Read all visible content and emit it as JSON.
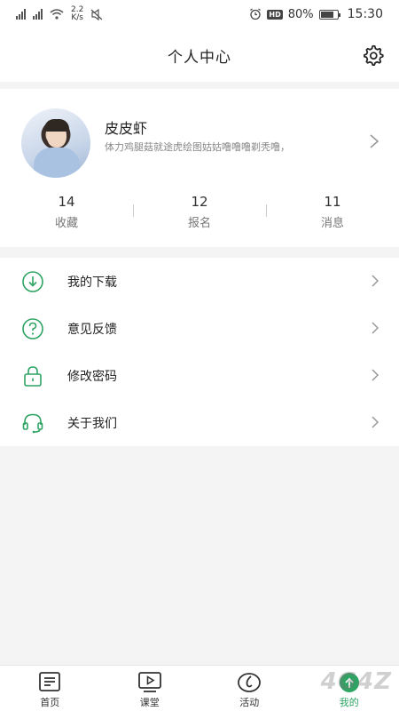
{
  "statusbar": {
    "net_speed_value": "2.2",
    "net_speed_unit": "K/s",
    "battery": "80%",
    "time": "15:30",
    "hd_label": "HD"
  },
  "header": {
    "title": "个人中心"
  },
  "profile": {
    "username": "皮皮虾",
    "bio": "体力鸡腿菇就途虎绘图姑姑噜噜噜剃秃噜，"
  },
  "stats": [
    {
      "value": "14",
      "label": "收藏"
    },
    {
      "value": "12",
      "label": "报名"
    },
    {
      "value": "11",
      "label": "消息"
    }
  ],
  "menu": [
    {
      "label": "我的下载",
      "icon": "download-icon"
    },
    {
      "label": "意见反馈",
      "icon": "question-icon"
    },
    {
      "label": "修改密码",
      "icon": "lock-icon"
    },
    {
      "label": "关于我们",
      "icon": "headset-icon"
    }
  ],
  "tabs": [
    {
      "label": "首页",
      "icon": "home-doc-icon"
    },
    {
      "label": "课堂",
      "icon": "video-play-icon"
    },
    {
      "label": "活动",
      "icon": "activity-icon"
    },
    {
      "label": "我的",
      "icon": "profile-icon"
    }
  ],
  "colors": {
    "accent": "#2ea463",
    "background": "#f4f4f4"
  },
  "watermark": "4G4Z"
}
